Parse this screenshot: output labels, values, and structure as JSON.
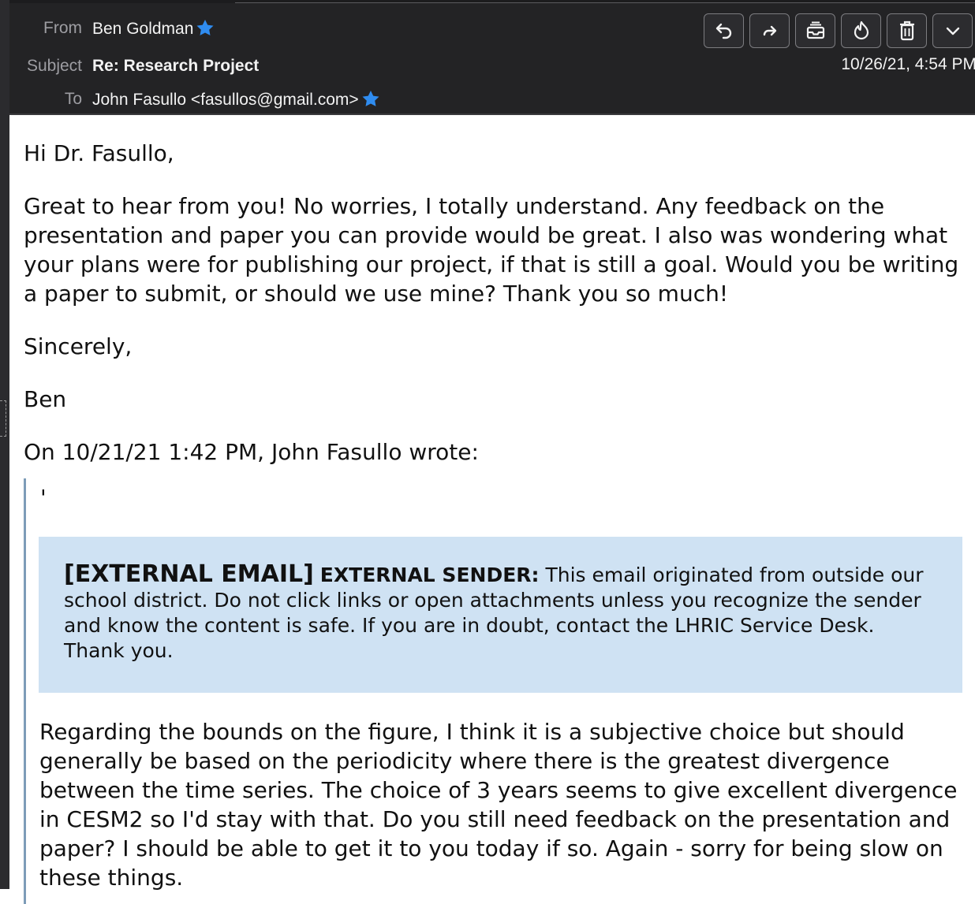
{
  "header": {
    "from_label": "From",
    "from_value": "Ben Goldman",
    "subject_label": "Subject",
    "subject_value": "Re: Research Project",
    "to_label": "To",
    "to_value": "John Fasullo <fasullos@gmail.com>",
    "date": "10/26/21, 4:54 PM",
    "toolbar": [
      "reply-icon",
      "forward-icon",
      "archive-icon",
      "junk-icon",
      "delete-icon",
      "more-icon"
    ],
    "star_color": "#2f8cf0"
  },
  "message": {
    "greeting": "Hi Dr. Fasullo,",
    "body": "Great to hear from you! No worries, I totally understand. Any feedback on the presentation and paper you can provide would be great. I also was wondering what your plans were for publishing our project, if that is still a goal. Would you be writing a paper to submit, or should we use mine? Thank you so much!",
    "closing": "Sincerely,",
    "signature": "Ben",
    "quote_header": "On 10/21/21 1:42 PM, John Fasullo wrote:"
  },
  "quoted": {
    "stray_mark": "'",
    "banner_tag": "[EXTERNAL EMAIL]",
    "banner_sender_label": "EXTERNAL SENDER:",
    "banner_text": " This email originated from outside our school district. Do not click links or open attachments unless you recognize the sender and know the content is safe. If you are in doubt, contact the LHRIC Service Desk. Thank you.",
    "banner_color": "#cfe2f3",
    "body": "Regarding the bounds on the figure, I think it is a subjective choice but should generally be based on the periodicity where there is the greatest divergence between the time series. The choice of 3 years seems to give excellent divergence in CESM2 so I'd stay with that. Do you still need feedback on the presentation and paper? I should be able to get it to you today if so. Again - sorry for being slow on these things."
  }
}
